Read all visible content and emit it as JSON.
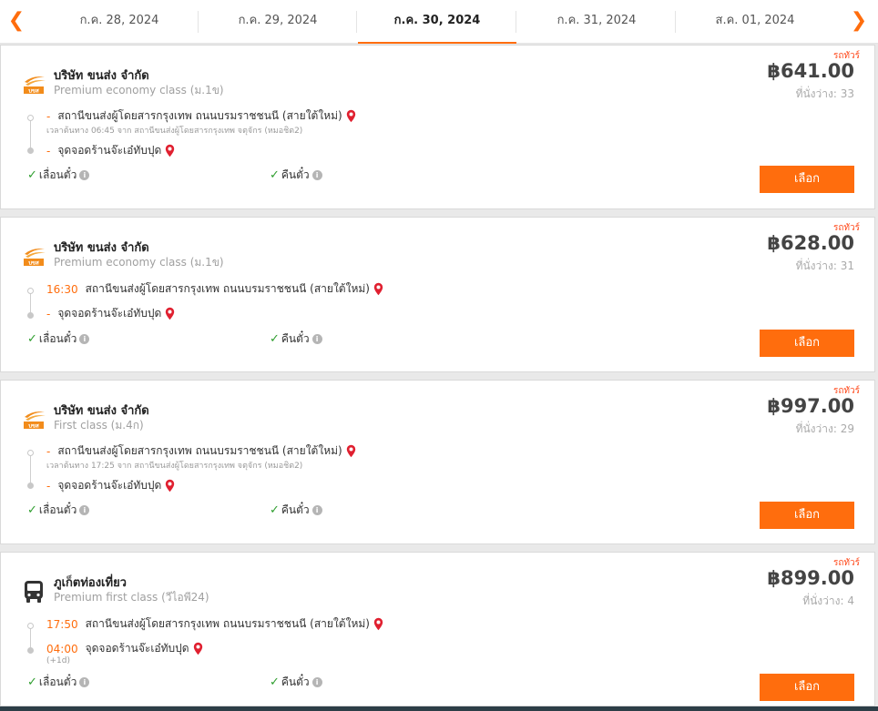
{
  "dates": {
    "prev_icon": "chevron-left-icon",
    "next_icon": "chevron-right-icon",
    "tabs": [
      {
        "label": "ก.ค. 28, 2024",
        "active": false
      },
      {
        "label": "ก.ค. 29, 2024",
        "active": false
      },
      {
        "label": "ก.ค. 30, 2024",
        "active": true
      },
      {
        "label": "ก.ค. 31, 2024",
        "active": false
      },
      {
        "label": "ส.ค. 01, 2024",
        "active": false
      }
    ]
  },
  "colors": {
    "accent": "#ff6d0d",
    "bus_type": "#ff4a1c",
    "check": "#2f9e2f",
    "pin": "#e02030",
    "footer": "#2d3e47"
  },
  "results": [
    {
      "bus_type": "รถทัวร์",
      "operator": "บริษัท ขนส่ง จำกัด",
      "class": "Premium economy class (ม.1ข)",
      "logo_icon": "bkc-logo-icon",
      "price": "฿641.00",
      "seats": "ที่นั่งว่าง: 33",
      "departure_time": "-",
      "departure_station": "สถานีขนส่งผู้โดยสารกรุงเทพ ถนนบรมราชชนนี (สายใต้ใหม่)",
      "departure_note": "เวลาต้นทาง 06:45  จาก สถานีขนส่งผู้โดยสารกรุงเทพ จตุจักร (หมอชิต2)",
      "arrival_time": "-",
      "arrival_station": "จุดจอดร้านจ๊ะเอ๋ทับปุด",
      "reschedule": "เลื่อนตั๋ว",
      "refund": "คืนตั๋ว",
      "select": "เลือก"
    },
    {
      "bus_type": "รถทัวร์",
      "operator": "บริษัท ขนส่ง จำกัด",
      "class": "Premium economy class (ม.1ข)",
      "logo_icon": "bkc-logo-icon",
      "price": "฿628.00",
      "seats": "ที่นั่งว่าง: 31",
      "departure_time": "16:30",
      "departure_station": "สถานีขนส่งผู้โดยสารกรุงเทพ ถนนบรมราชชนนี (สายใต้ใหม่)",
      "arrival_time": "-",
      "arrival_station": "จุดจอดร้านจ๊ะเอ๋ทับปุด",
      "reschedule": "เลื่อนตั๋ว",
      "refund": "คืนตั๋ว",
      "select": "เลือก"
    },
    {
      "bus_type": "รถทัวร์",
      "operator": "บริษัท ขนส่ง จำกัด",
      "class": "First class (ม.4ก)",
      "logo_icon": "bkc-logo-icon",
      "price": "฿997.00",
      "seats": "ที่นั่งว่าง: 29",
      "departure_time": "-",
      "departure_station": "สถานีขนส่งผู้โดยสารกรุงเทพ ถนนบรมราชชนนี (สายใต้ใหม่)",
      "departure_note": "เวลาต้นทาง 17:25  จาก สถานีขนส่งผู้โดยสารกรุงเทพ จตุจักร (หมอชิต2)",
      "arrival_time": "-",
      "arrival_station": "จุดจอดร้านจ๊ะเอ๋ทับปุด",
      "reschedule": "เลื่อนตั๋ว",
      "refund": "คืนตั๋ว",
      "select": "เลือก"
    },
    {
      "bus_type": "รถทัวร์",
      "operator": "ภูเก็ตท่องเที่ยว",
      "class": "Premium first class (วีไอพี24)",
      "logo_icon": "bus-icon",
      "price": "฿899.00",
      "seats": "ที่นั่งว่าง: 4",
      "departure_time": "17:50",
      "departure_station": "สถานีขนส่งผู้โดยสารกรุงเทพ ถนนบรมราชชนนี (สายใต้ใหม่)",
      "arrival_time": "04:00",
      "arrival_station": "จุดจอดร้านจ๊ะเอ๋ทับปุด",
      "arrival_day_offset": "(+1d)",
      "reschedule": "เลื่อนตั๋ว",
      "refund": "คืนตั๋ว",
      "select": "เลือก"
    }
  ]
}
